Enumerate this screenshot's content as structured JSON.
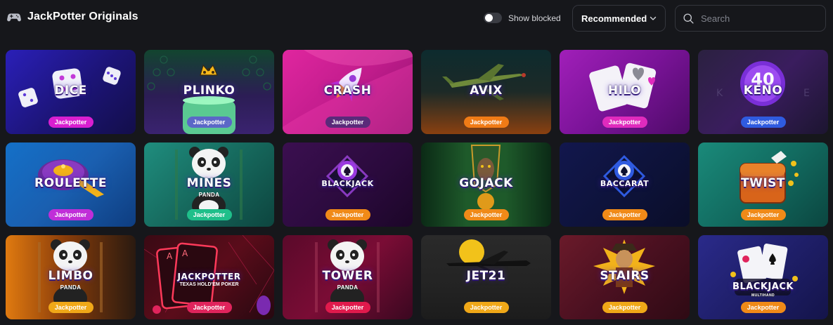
{
  "header": {
    "title": "JackPotter Originals",
    "show_blocked_label": "Show blocked",
    "sort_value": "Recommended",
    "search_placeholder": "Search"
  },
  "games": [
    {
      "name": "DICE",
      "sub": "",
      "badge": "Jackpotter",
      "bg": "linear-gradient(135deg,#2a1fb8 0%,#1c1476 55%,#130e4a 100%)",
      "badge_color": "#d81fd0"
    },
    {
      "name": "PLINKO",
      "sub": "",
      "badge": "Jackpotter",
      "bg": "linear-gradient(180deg,#12452f 0%,#2c1d55 55%,#3a2370 100%)",
      "badge_color": "#5b67c7"
    },
    {
      "name": "CRASH",
      "sub": "",
      "badge": "Jackpotter",
      "bg": "linear-gradient(135deg,#e0269f 0%,#c11c8c 50%,#8c136d 100%)",
      "badge_color": "#5a2a7a"
    },
    {
      "name": "AVIX",
      "sub": "",
      "badge": "Jackpotter",
      "bg": "linear-gradient(180deg,#0d2b2e 0%,#1d2a27 50%,#8a4010 100%)",
      "badge_color": "#f07b16"
    },
    {
      "name": "HILO",
      "sub": "",
      "badge": "Jackpotter",
      "bg": "linear-gradient(135deg,#a11fb9 0%,#7a1398 50%,#4d0b67 100%)",
      "badge_color": "#e02bbd"
    },
    {
      "name": "KENO",
      "sub": "",
      "badge": "Jackpotter",
      "bg": "linear-gradient(135deg,#2b2140 0%,#3a1d5e 50%,#1c1530 100%)",
      "badge_color": "#2f5be0"
    },
    {
      "name": "ROULETTE",
      "sub": "",
      "badge": "Jackpotter",
      "bg": "linear-gradient(135deg,#1470c8 0%,#1a5fb0 50%,#0e3d80 100%)",
      "badge_color": "#c02ed8"
    },
    {
      "name": "MINES",
      "sub": "PANDA",
      "badge": "Jackpotter",
      "bg": "linear-gradient(135deg,#1f8d7e 0%,#16695d 50%,#0d453f 100%)",
      "badge_color": "#1fbf8a"
    },
    {
      "name": "BLACKJACK",
      "sub": "",
      "badge": "Jackpotter",
      "bg": "linear-gradient(135deg,#3b0f50 0%,#2a0a3c 60%,#1c0628 100%)",
      "badge_color": "#f08a18"
    },
    {
      "name": "GOJACK",
      "sub": "",
      "badge": "Jackpotter",
      "bg": "linear-gradient(90deg,#0b2a16 0%,#1e5a2a 35%,#1e5a2a 65%,#0b2a16 100%)",
      "badge_color": "#f08a18"
    },
    {
      "name": "BACCARAT",
      "sub": "",
      "badge": "Jackpotter",
      "bg": "linear-gradient(135deg,#12174d 0%,#0d1238 60%,#0a0d28 100%)",
      "badge_color": "#f08a18"
    },
    {
      "name": "TWIST",
      "sub": "",
      "badge": "Jackpotter",
      "bg": "linear-gradient(135deg,#1a8a7a 0%,#126b60 50%,#0b4640 100%)",
      "badge_color": "#f08a18"
    },
    {
      "name": "LIMBO",
      "sub": "PANDA",
      "badge": "Jackpotter",
      "bg": "linear-gradient(90deg,#e07a10 0%,#8a3d0a 45%,#2a1a10 100%)",
      "badge_color": "#f0a818"
    },
    {
      "name": "JACKPOTTER",
      "sub": "TEXAS HOLD'EM POKER",
      "badge": "Jackpotter",
      "bg": "linear-gradient(135deg,#3a0a14 0%,#5a0c1a 50%,#260810 100%)",
      "badge_color": "#e0245c"
    },
    {
      "name": "TOWER",
      "sub": "PANDA",
      "badge": "Jackpotter",
      "bg": "linear-gradient(135deg,#5a0a2a 0%,#7a0c35 50%,#3a0820 100%)",
      "badge_color": "#e01a4c"
    },
    {
      "name": "JET21",
      "sub": "",
      "badge": "Jackpotter",
      "bg": "linear-gradient(180deg,#2a2a2a 0%,#232323 60%,#1c1c1c 100%)",
      "badge_color": "#f0a818"
    },
    {
      "name": "STAIRS",
      "sub": "",
      "badge": "Jackpotter",
      "bg": "linear-gradient(135deg,#6a1a2a 0%,#4a1020 50%,#2e0a14 100%)",
      "badge_color": "#f0a818"
    },
    {
      "name": "BLACKJACK",
      "sub": "MULTIHAND",
      "badge": "Jackpotter",
      "bg": "linear-gradient(135deg,#2a2a8a 0%,#1f1f6a 50%,#14144a 100%)",
      "badge_color": "#f08a18"
    }
  ]
}
